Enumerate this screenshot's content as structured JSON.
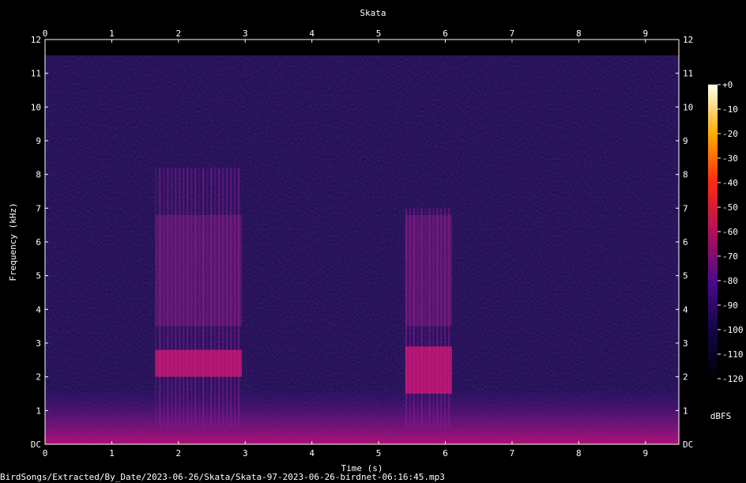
{
  "chart_data": {
    "type": "heatmap",
    "title": "Skata",
    "xlabel": "Time (s)",
    "ylabel": "Frequency (kHz)",
    "xlim": [
      0,
      9.5
    ],
    "ylim": [
      0,
      12
    ],
    "x_ticks": [
      "0",
      "1",
      "2",
      "3",
      "4",
      "5",
      "6",
      "7",
      "8",
      "9"
    ],
    "y_ticks": [
      "DC",
      "1",
      "2",
      "3",
      "4",
      "5",
      "6",
      "7",
      "8",
      "9",
      "10",
      "11",
      "12"
    ],
    "colorbar": {
      "label": "dBFS",
      "range": [
        -120,
        0
      ],
      "ticks": [
        "+0",
        "-10",
        "-20",
        "-30",
        "-40",
        "-50",
        "-60",
        "-70",
        "-80",
        "-90",
        "-100",
        "-110",
        "-120"
      ]
    },
    "calls": [
      {
        "t_start": 1.65,
        "t_end": 2.95,
        "f_low": 0.5,
        "f_high": 8.2,
        "strong_band": [
          2.0,
          2.8
        ]
      },
      {
        "t_start": 5.4,
        "t_end": 6.1,
        "f_low": 0.5,
        "f_high": 7.0,
        "strong_band": [
          1.5,
          2.9
        ]
      }
    ]
  },
  "footer": {
    "path": "BirdSongs/Extracted/By_Date/2023-06-26/Skata/Skata-97-2023-06-26-birdnet-06:16:45.mp3"
  },
  "colors": {
    "background": "#000000",
    "spectrogram_base": "#1e0a4a",
    "call_high": "#d81878"
  }
}
